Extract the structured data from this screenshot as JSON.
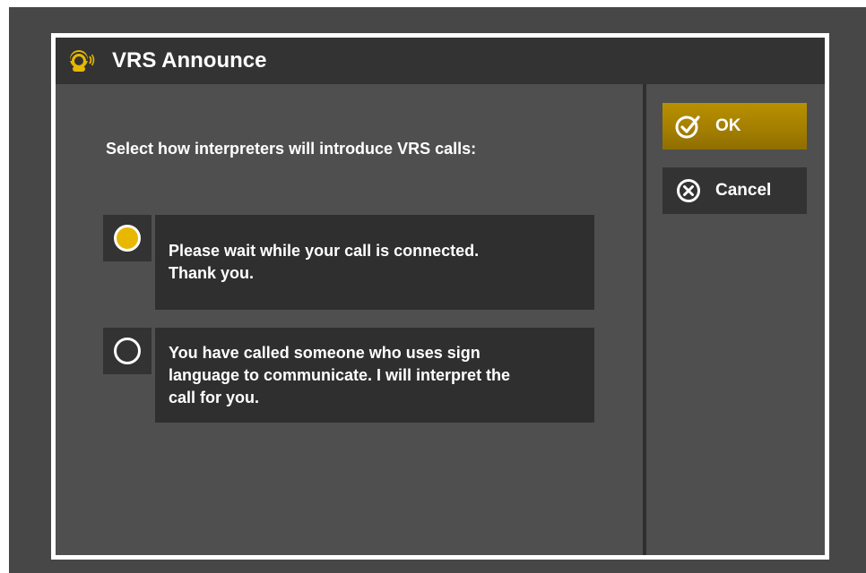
{
  "dialog": {
    "title": "VRS Announce",
    "title_icon": "interpreter-headset-icon",
    "instruction": "Select how interpreters will introduce VRS calls:"
  },
  "options": [
    {
      "text": "Please wait while your call is connected.\nThank you.",
      "selected": true
    },
    {
      "text": "You have called someone who uses sign\nlanguage to communicate.  I will interpret the\ncall for you.",
      "selected": false
    }
  ],
  "actions": {
    "ok_label": "OK",
    "ok_icon": "check-circle-icon",
    "cancel_label": "Cancel",
    "cancel_icon": "x-circle-icon"
  },
  "colors": {
    "accent": "#e8b800",
    "ok_button": "#a47f00",
    "panel": "#333333",
    "background": "#4f4f4f"
  }
}
